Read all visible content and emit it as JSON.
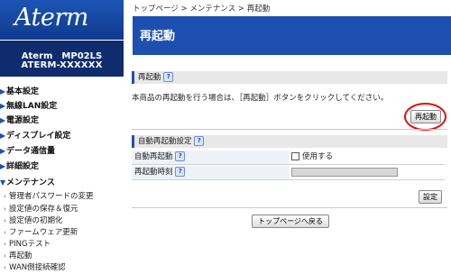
{
  "brand": {
    "logo": "Aterm",
    "model": "Aterm　MP02LS",
    "serial": "ATERM-XXXXXX"
  },
  "sidebar": {
    "items": [
      {
        "label": "基本設定"
      },
      {
        "label": "無線LAN設定"
      },
      {
        "label": "電源設定"
      },
      {
        "label": "ディスプレイ設定"
      },
      {
        "label": "データ通信量"
      },
      {
        "label": "詳細設定"
      },
      {
        "label": "メンテナンス"
      }
    ],
    "sub_items": [
      {
        "label": "管理者パスワードの変更"
      },
      {
        "label": "設定値の保存＆復元"
      },
      {
        "label": "設定値の初期化"
      },
      {
        "label": "ファームウェア更新"
      },
      {
        "label": "PINGテスト"
      },
      {
        "label": "再起動"
      },
      {
        "label": "WAN側接続確認"
      }
    ]
  },
  "breadcrumb": "トップページ > メンテナンス > 再起動",
  "page_title": "再起動",
  "restart_section": {
    "heading": "再起動",
    "help": "?",
    "description": "本商品の再起動を行う場合は、［再起動］ボタンをクリックしてください。",
    "button": "再起動"
  },
  "auto_section": {
    "heading": "自動再起動設定",
    "help": "?",
    "rows": [
      {
        "label": "自動再起動",
        "help": "?",
        "checkbox_label": "使用する"
      },
      {
        "label": "再起動時刻",
        "help": "?"
      }
    ],
    "set_button": "設定"
  },
  "back_button": "トップページへ戻る",
  "colors": {
    "accent": "#1d4fb0",
    "highlight_ring": "#e01010"
  }
}
